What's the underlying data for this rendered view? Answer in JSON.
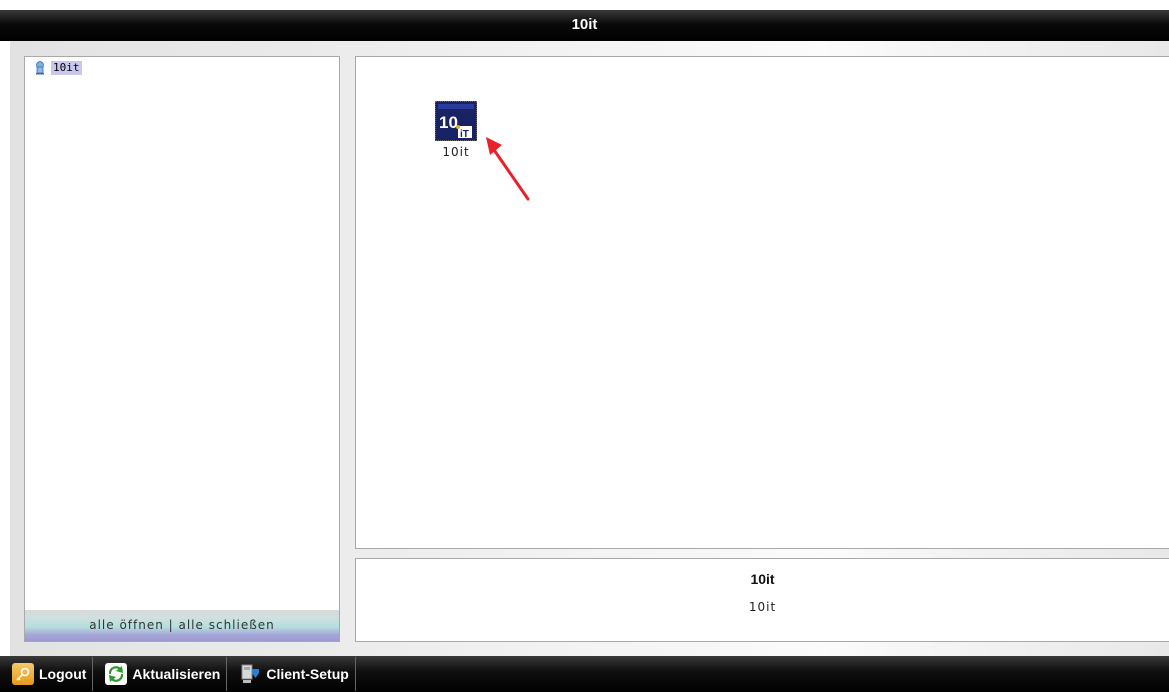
{
  "window": {
    "title": "10it"
  },
  "tree": {
    "root_label": "10it",
    "footer_text": "alle öffnen | alle schließen"
  },
  "main": {
    "tile_label": "10it",
    "tile_logo_text": "10",
    "tile_logo_sub": "iT"
  },
  "info": {
    "title": "10it",
    "subtitle": "10it"
  },
  "toolbar": {
    "logout_label": "Logout",
    "refresh_label": "Aktualisieren",
    "setup_label": "Client-Setup"
  },
  "colors": {
    "accent_arrow": "#e8212a",
    "tile_bg": "#1a2266",
    "tree_selection": "#c8c8ec"
  },
  "icons": {
    "logout": "key-icon",
    "refresh": "refresh-arrows-icon",
    "setup": "computer-download-icon",
    "tree_root": "server-icon"
  }
}
